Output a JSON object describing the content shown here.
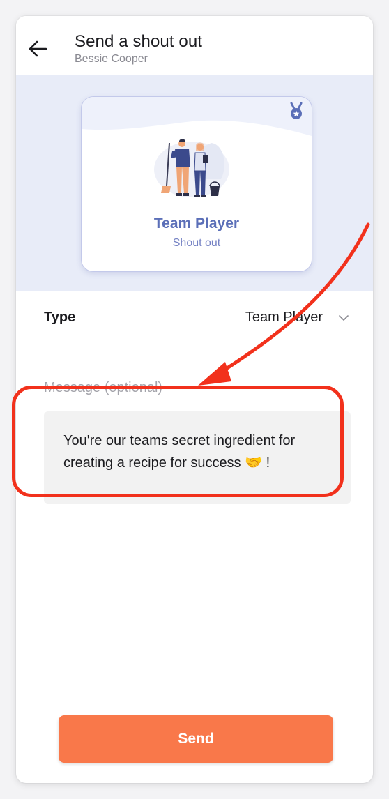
{
  "header": {
    "title": "Send a shout out",
    "recipient": "Bessie Cooper"
  },
  "card": {
    "title": "Team Player",
    "subtitle": "Shout out",
    "icon": "medal-icon",
    "accent_color": "#5b6fb8"
  },
  "form": {
    "type_label": "Type",
    "type_value": "Team Player",
    "message_label": "Message (optional)",
    "message_value": "You're our teams secret ingredient for creating a recipe for success 🤝 !"
  },
  "actions": {
    "send_label": "Send",
    "send_color": "#f9784a"
  },
  "annotation": {
    "color": "#f2311c"
  }
}
